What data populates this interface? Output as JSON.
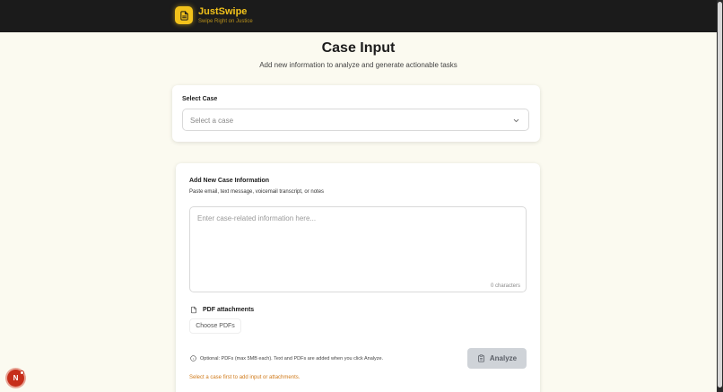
{
  "header": {
    "app_name": "JustSwipe",
    "tagline": "Swipe Right on Justice",
    "logo_icon": "document-icon",
    "brand_color": "#f2c21b"
  },
  "page": {
    "title": "Case Input",
    "subtitle": "Add new information to analyze and generate actionable tasks"
  },
  "select_case": {
    "label": "Select Case",
    "placeholder": "Select a case",
    "icon": "chevron-down-icon"
  },
  "new_info": {
    "label": "Add New Case Information",
    "hint": "Paste email, text message, voicemail transcript, or notes",
    "textarea_placeholder": "Enter case-related information here...",
    "char_count": "0 characters",
    "pdf_label": "PDF attachments",
    "choose_button": "Choose PDFs",
    "info_note": "Optional: PDFs (max 5MB each). Text and PDFs are added when you click Analyze.",
    "analyze_button": "Analyze",
    "warning": "Select a case first to add input or attachments."
  },
  "user": {
    "avatar_initial": "N"
  },
  "colors": {
    "warning": "#d07a1a",
    "avatar": "#c62e1a",
    "disabled_button": "#cfd3d8"
  }
}
